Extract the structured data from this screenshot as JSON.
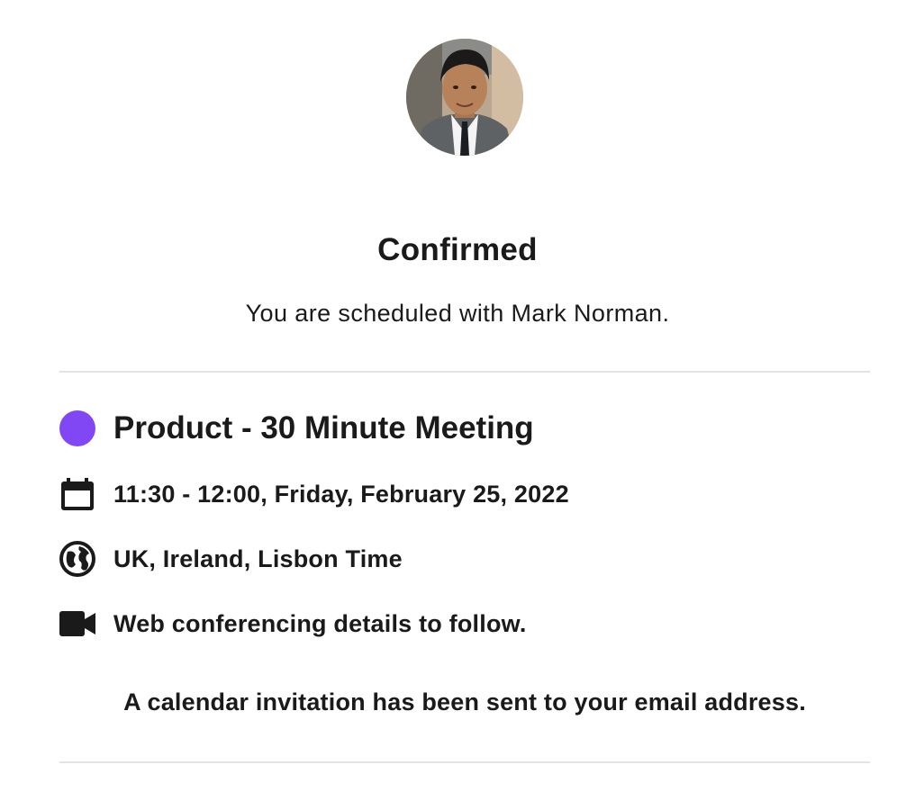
{
  "header": {
    "avatar_alt": "Mark Norman"
  },
  "confirmation": {
    "title": "Confirmed",
    "subtitle": "You are scheduled with Mark Norman."
  },
  "event": {
    "name": "Product - 30 Minute Meeting",
    "color": "#8247f5",
    "datetime": "11:30 - 12:00, Friday, February 25, 2022",
    "timezone": "UK, Ireland, Lisbon Time",
    "conferencing": "Web conferencing details to follow."
  },
  "icons": {
    "event_color": "color-dot-icon",
    "date": "calendar-icon",
    "timezone": "globe-icon",
    "conferencing": "video-camera-icon"
  },
  "footer": {
    "note": "A calendar invitation has been sent to your email address."
  },
  "colors": {
    "text": "#1a1a1a",
    "divider": "#e3e3e3",
    "accent": "#8247f5"
  }
}
